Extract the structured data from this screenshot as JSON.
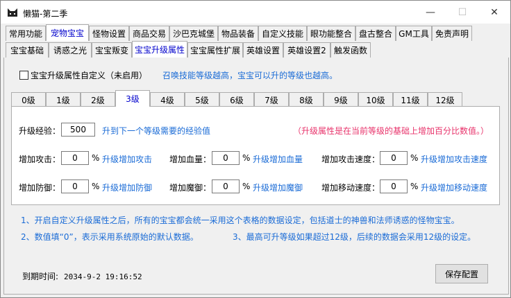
{
  "window": {
    "title": "懒猫-第二季"
  },
  "main_tabs": [
    {
      "label": "常用功能"
    },
    {
      "label": "宠物宝宝"
    },
    {
      "label": "怪物设置"
    },
    {
      "label": "商品交易"
    },
    {
      "label": "沙巴克城堡"
    },
    {
      "label": "物品装备"
    },
    {
      "label": "自定义技能"
    },
    {
      "label": "眼功能整合"
    },
    {
      "label": "盘古整合"
    },
    {
      "label": "GM工具"
    },
    {
      "label": "免责声明"
    }
  ],
  "sub_tabs": [
    {
      "label": "宝宝基础"
    },
    {
      "label": "诱惑之光"
    },
    {
      "label": "宝宝叛变"
    },
    {
      "label": "宝宝升级属性"
    },
    {
      "label": "宝宝属性扩展"
    },
    {
      "label": "英雄设置"
    },
    {
      "label": "英雄设置2"
    },
    {
      "label": "触发函数"
    }
  ],
  "custom_checkbox": {
    "label": "宝宝升级属性自定义（未启用）",
    "checked": false
  },
  "hint": "召唤技能等级越高，宝宝可以升的等级也越高。",
  "level_tabs": [
    "0级",
    "1级",
    "2级",
    "3级",
    "4级",
    "5级",
    "6级",
    "7级",
    "8级",
    "9级",
    "10级",
    "11级",
    "12级"
  ],
  "active_level": "3级",
  "exp": {
    "label": "升级经验：",
    "value": "500",
    "desc": "升到下一个等级需要的经验值"
  },
  "upgrade_note": "（升级属性是在当前等级的基础上增加百分比数值。）",
  "fields": {
    "attack": {
      "label": "增加攻击：",
      "value": "0",
      "unit": "%",
      "desc": "升级增加攻击"
    },
    "hp": {
      "label": "增加血量：",
      "value": "0",
      "unit": "%",
      "desc": "升级增加血量"
    },
    "attack_speed": {
      "label": "增加攻击速度：",
      "value": "0",
      "unit": "%",
      "desc": "升级增加攻击速度"
    },
    "defense": {
      "label": "增加防御：",
      "value": "0",
      "unit": "%",
      "desc": "升级增加防御"
    },
    "magic_def": {
      "label": "增加魔御：",
      "value": "0",
      "unit": "%",
      "desc": "升级增加魔御"
    },
    "move_speed": {
      "label": "增加移动速度：",
      "value": "0",
      "unit": "%",
      "desc": "升级增加移动速度"
    }
  },
  "notes": {
    "n1": "1、开启自定义升级属性之后，所有的宝宝都会统一采用这个表格的数据设定，包括道士的神兽和法师诱惑的怪物宝宝。",
    "n2": "2、数值填“0”，表示采用系统原始的默认数据。",
    "n3": "3、最高可升等级如果超过12级，后续的数据会采用12级的设定。"
  },
  "footer": {
    "expiry_label": "到期时间:",
    "expiry_value": "2034-9-2 19:16:52",
    "save_label": "保存配置"
  },
  "icons": {
    "minimize": "minimize-icon",
    "maximize": "maximize-icon",
    "close": "close-icon",
    "app": "cat-app-icon"
  }
}
